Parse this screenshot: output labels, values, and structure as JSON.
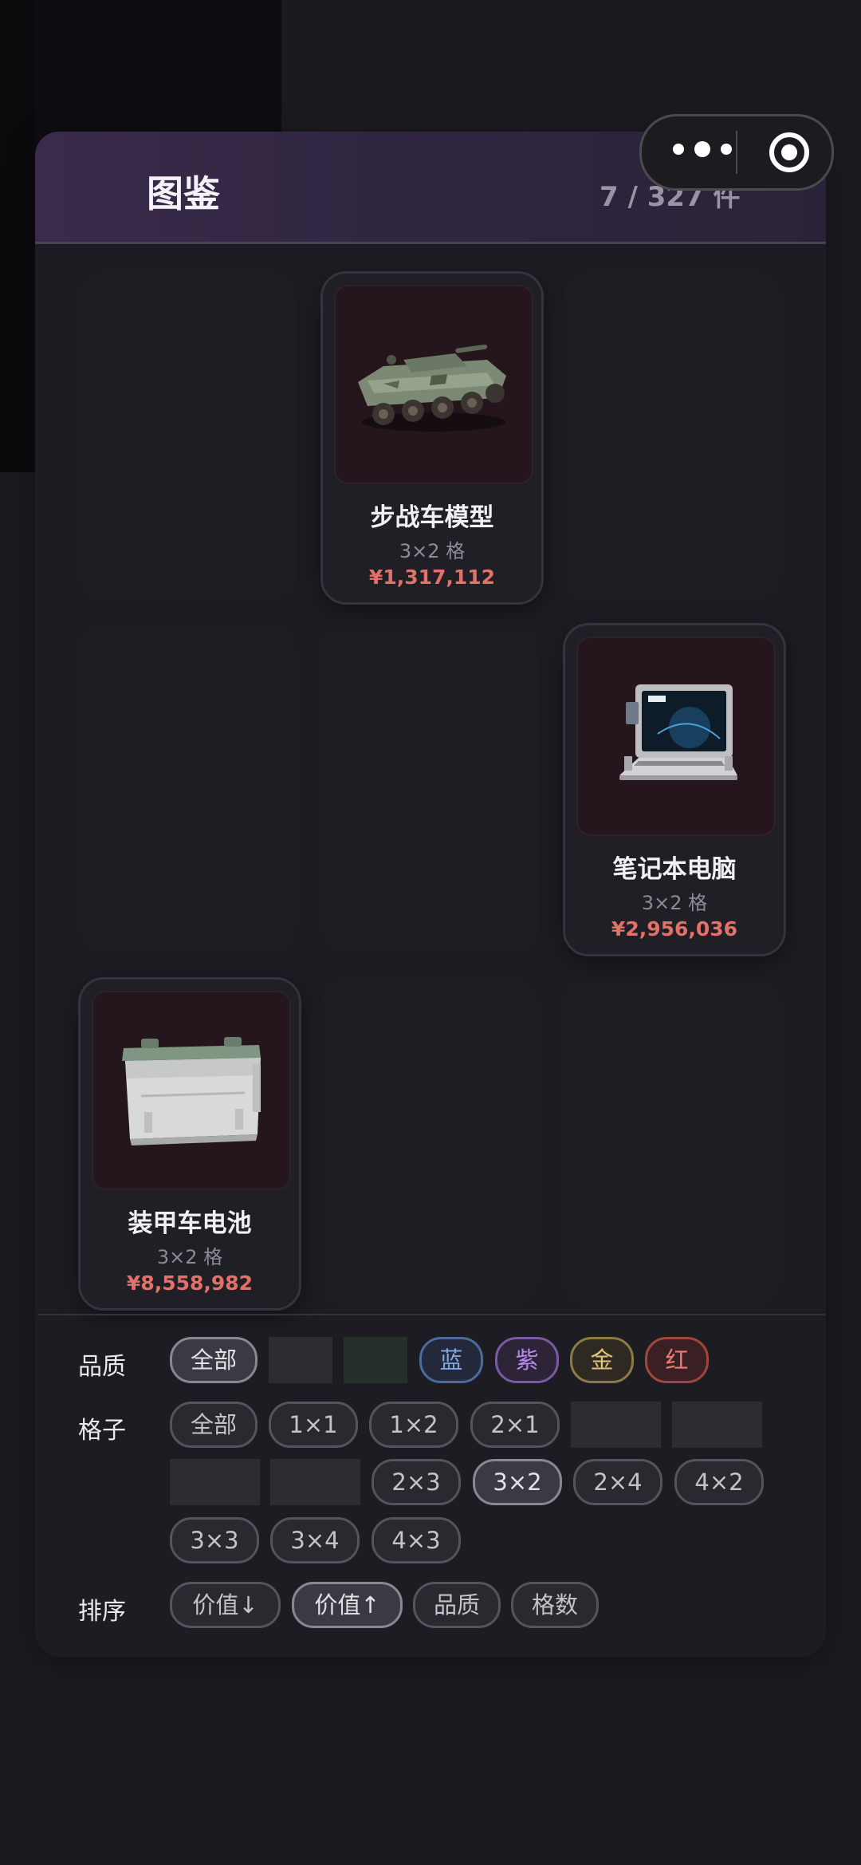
{
  "header": {
    "title": "图鉴",
    "count": "7 / 327 件"
  },
  "capsule": {
    "menu_icon": "more-dots-icon",
    "target_icon": "target-icon"
  },
  "items": [
    {
      "name": "步战车模型",
      "size": "3×2 格",
      "price": "¥1,317,112",
      "icon": "armored-vehicle-model"
    },
    {
      "name": "笔记本电脑",
      "size": "3×2 格",
      "price": "¥2,956,036",
      "icon": "rugged-laptop"
    },
    {
      "name": "装甲车电池",
      "size": "3×2 格",
      "price": "¥8,558,982",
      "icon": "vehicle-battery"
    }
  ],
  "filters": {
    "quality": {
      "label": "品质",
      "options": [
        "全部",
        "蓝",
        "紫",
        "金",
        "红"
      ]
    },
    "grid": {
      "label": "格子",
      "options": [
        "全部",
        "1×1",
        "1×2",
        "2×1",
        "2×3",
        "3×2",
        "2×4",
        "4×2",
        "3×3",
        "3×4",
        "4×3"
      ],
      "selected": "3×2"
    },
    "sort": {
      "label": "排序",
      "options": [
        "价值↓",
        "价值↑",
        "品质",
        "格数"
      ],
      "selected": "价值↑"
    }
  },
  "colors": {
    "accent_price": "#e2716a",
    "quality_blue": "#7fa6e3",
    "quality_purple": "#b58ae8",
    "quality_gold": "#e1c37a",
    "quality_red": "#f07b73"
  }
}
